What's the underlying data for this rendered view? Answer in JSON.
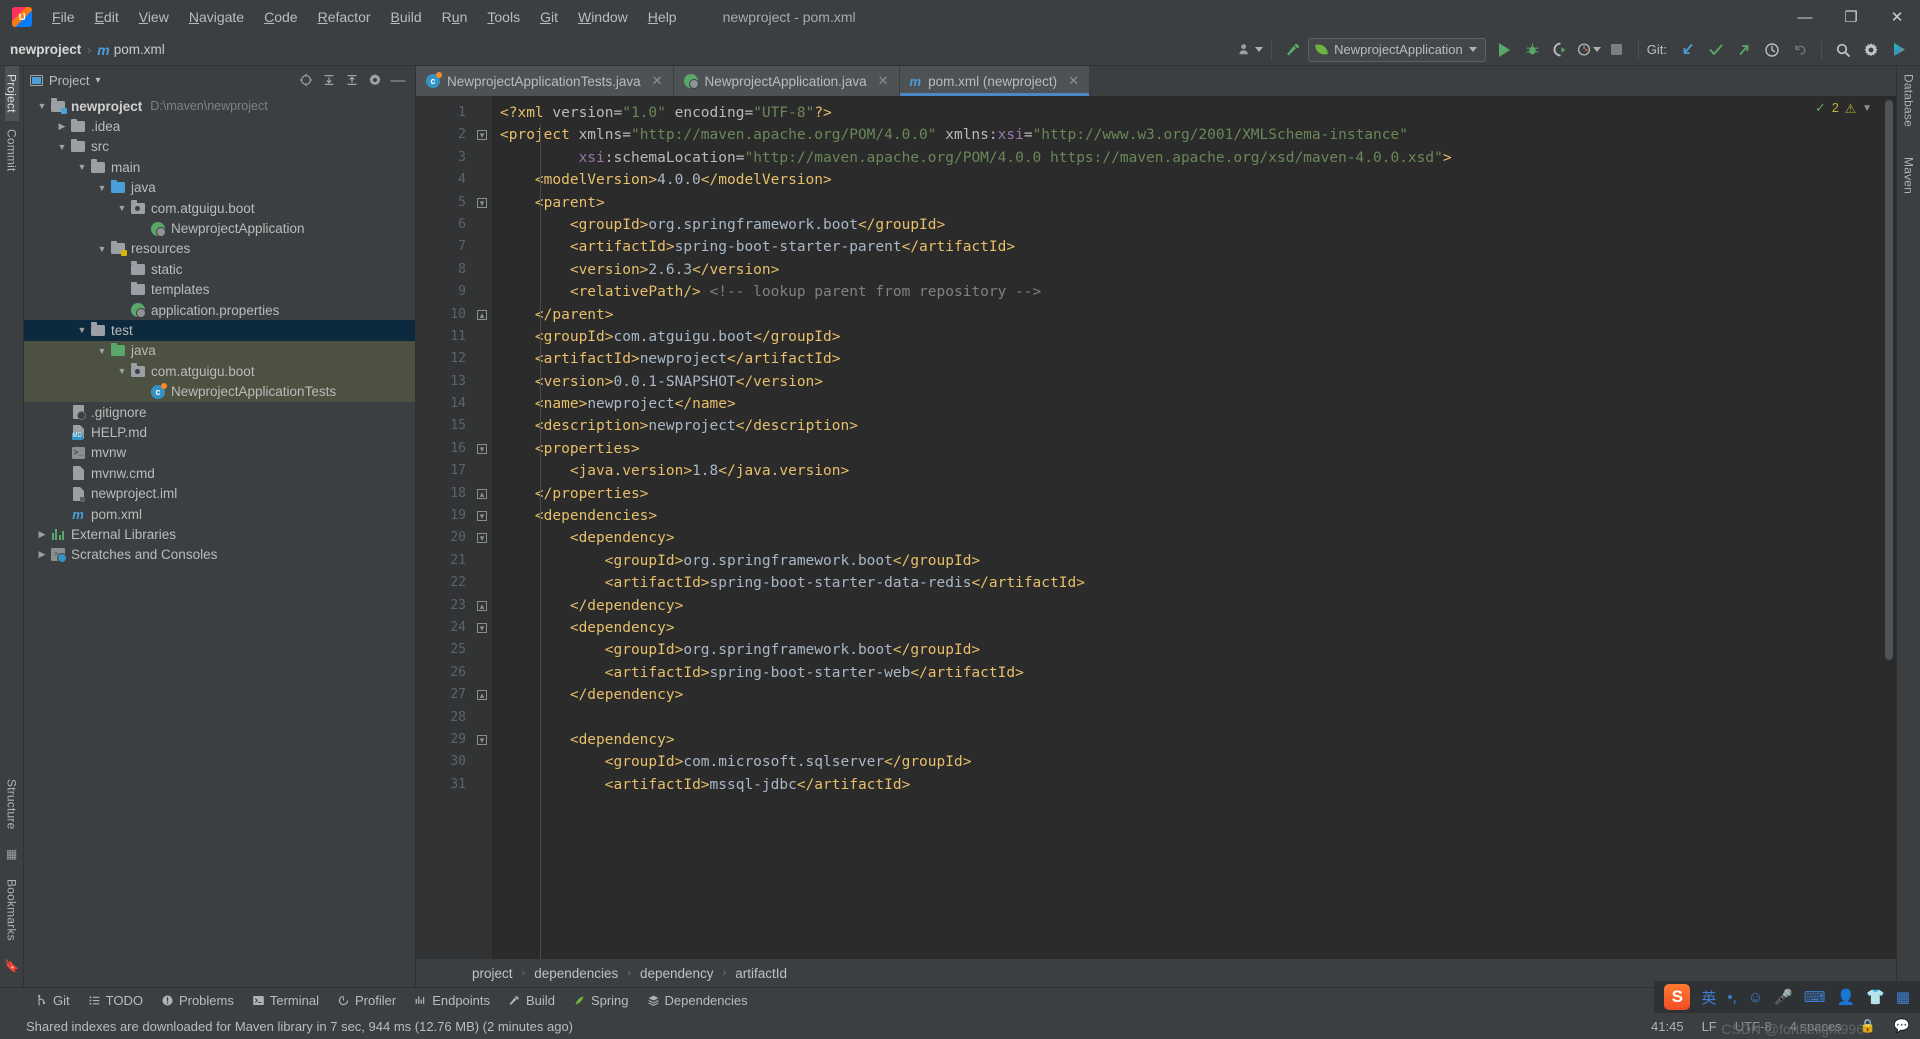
{
  "window": {
    "title": "newproject - pom.xml",
    "minimize": "—",
    "maximize": "❐",
    "close": "✕"
  },
  "menu": {
    "items": [
      {
        "pre": "",
        "u": "F",
        "post": "ile"
      },
      {
        "pre": "",
        "u": "E",
        "post": "dit"
      },
      {
        "pre": "",
        "u": "V",
        "post": "iew"
      },
      {
        "pre": "",
        "u": "N",
        "post": "avigate"
      },
      {
        "pre": "",
        "u": "C",
        "post": "ode"
      },
      {
        "pre": "",
        "u": "R",
        "post": "efactor"
      },
      {
        "pre": "",
        "u": "B",
        "post": "uild"
      },
      {
        "pre": "R",
        "u": "u",
        "post": "n"
      },
      {
        "pre": "",
        "u": "T",
        "post": "ools"
      },
      {
        "pre": "",
        "u": "G",
        "post": "it"
      },
      {
        "pre": "",
        "u": "W",
        "post": "indow"
      },
      {
        "pre": "",
        "u": "H",
        "post": "elp"
      }
    ]
  },
  "navbar": {
    "project": "newproject",
    "separator": "›",
    "file": "pom.xml",
    "file_icon_letter": "m",
    "run_config": "NewprojectApplication",
    "git_label": "Git:",
    "icons": {
      "user": "user-settings-icon",
      "build": "build-hammer-icon",
      "run": "run-icon",
      "debug": "debug-icon",
      "coverage": "run-with-coverage-icon",
      "profiler": "profiler-icon",
      "stop": "stop-icon",
      "update": "git-update-icon",
      "commit": "git-commit-icon",
      "push": "git-push-icon",
      "history": "git-history-icon",
      "rollback": "git-rollback-icon",
      "search": "search-everywhere-icon",
      "settings": "settings-gear-icon",
      "ai": "ai-assistant-icon"
    }
  },
  "left_strip": {
    "project_label": "Project",
    "commit_label": "Commit",
    "structure_label": "Structure",
    "bookmarks_label": "Bookmarks"
  },
  "right_strip": {
    "database_label": "Database",
    "maven_label": "Maven"
  },
  "project_panel": {
    "title": "Project",
    "chevron": "▾",
    "actions": [
      "locate-icon",
      "expand-all-icon",
      "collapse-all-icon",
      "settings-icon",
      "hide-icon"
    ],
    "tree": [
      {
        "indent": 0,
        "arrow": "v",
        "icon": "folder-module",
        "label": "newproject",
        "bold": true,
        "path": "D:\\maven\\newproject",
        "state": "normal"
      },
      {
        "indent": 1,
        "arrow": ">",
        "icon": "folder",
        "label": ".idea",
        "bold": false,
        "path": "",
        "state": "normal"
      },
      {
        "indent": 1,
        "arrow": "v",
        "icon": "folder",
        "label": "src",
        "bold": false,
        "path": "",
        "state": "normal"
      },
      {
        "indent": 2,
        "arrow": "v",
        "icon": "folder",
        "label": "main",
        "bold": false,
        "path": "",
        "state": "normal"
      },
      {
        "indent": 3,
        "arrow": "v",
        "icon": "folder-source",
        "label": "java",
        "bold": false,
        "path": "",
        "state": "normal"
      },
      {
        "indent": 4,
        "arrow": "v",
        "icon": "package",
        "label": "com.atguigu.boot",
        "bold": false,
        "path": "",
        "state": "normal"
      },
      {
        "indent": 5,
        "arrow": "",
        "icon": "spring-class",
        "label": "NewprojectApplication",
        "bold": false,
        "path": "",
        "state": "normal"
      },
      {
        "indent": 3,
        "arrow": "v",
        "icon": "folder-resource",
        "label": "resources",
        "bold": false,
        "path": "",
        "state": "normal"
      },
      {
        "indent": 4,
        "arrow": "",
        "icon": "folder",
        "label": "static",
        "bold": false,
        "path": "",
        "state": "normal"
      },
      {
        "indent": 4,
        "arrow": "",
        "icon": "folder",
        "label": "templates",
        "bold": false,
        "path": "",
        "state": "normal"
      },
      {
        "indent": 4,
        "arrow": "",
        "icon": "spring-props",
        "label": "application.properties",
        "bold": false,
        "path": "",
        "state": "normal"
      },
      {
        "indent": 2,
        "arrow": "v",
        "icon": "folder",
        "label": "test",
        "bold": false,
        "path": "",
        "state": "selected"
      },
      {
        "indent": 3,
        "arrow": "v",
        "icon": "folder-test",
        "label": "java",
        "bold": false,
        "path": "",
        "state": "highlight"
      },
      {
        "indent": 4,
        "arrow": "v",
        "icon": "package",
        "label": "com.atguigu.boot",
        "bold": false,
        "path": "",
        "state": "highlight"
      },
      {
        "indent": 5,
        "arrow": "",
        "icon": "test-class",
        "label": "NewprojectApplicationTests",
        "bold": false,
        "path": "",
        "state": "highlight"
      },
      {
        "indent": 1,
        "arrow": "",
        "icon": "gitignore",
        "label": ".gitignore",
        "bold": false,
        "path": "",
        "state": "normal"
      },
      {
        "indent": 1,
        "arrow": "",
        "icon": "markdown",
        "label": "HELP.md",
        "bold": false,
        "path": "",
        "state": "normal"
      },
      {
        "indent": 1,
        "arrow": "",
        "icon": "shell",
        "label": "mvnw",
        "bold": false,
        "path": "",
        "state": "normal"
      },
      {
        "indent": 1,
        "arrow": "",
        "icon": "file",
        "label": "mvnw.cmd",
        "bold": false,
        "path": "",
        "state": "normal"
      },
      {
        "indent": 1,
        "arrow": "",
        "icon": "iml",
        "label": "newproject.iml",
        "bold": false,
        "path": "",
        "state": "normal"
      },
      {
        "indent": 1,
        "arrow": "",
        "icon": "maven",
        "label": "pom.xml",
        "bold": false,
        "path": "",
        "state": "normal"
      },
      {
        "indent": 0,
        "arrow": ">",
        "icon": "libraries",
        "label": "External Libraries",
        "bold": false,
        "path": "",
        "state": "normal"
      },
      {
        "indent": 0,
        "arrow": ">",
        "icon": "scratches",
        "label": "Scratches and Consoles",
        "bold": false,
        "path": "",
        "state": "normal"
      }
    ]
  },
  "tabs": [
    {
      "label": "NewprojectApplicationTests.java",
      "icon": "test-class-icon",
      "active": false
    },
    {
      "label": "NewprojectApplication.java",
      "icon": "spring-class-icon",
      "active": false
    },
    {
      "label": "pom.xml (newproject)",
      "icon": "maven-icon",
      "active": true
    }
  ],
  "editor": {
    "inspection_count": "2",
    "first_line": 1,
    "lines": [
      {
        "n": 1,
        "fold": "",
        "segments": [
          {
            "t": "tg",
            "v": "<?xml "
          },
          {
            "t": "at",
            "v": "version="
          },
          {
            "t": "st",
            "v": "\"1.0\""
          },
          {
            "t": "at",
            "v": " encoding="
          },
          {
            "t": "st",
            "v": "\"UTF-8\""
          },
          {
            "t": "tg",
            "v": "?>"
          }
        ],
        "indent": 0
      },
      {
        "n": 2,
        "fold": "open",
        "segments": [
          {
            "t": "tg",
            "v": "<project "
          },
          {
            "t": "at",
            "v": "xmlns="
          },
          {
            "t": "st",
            "v": "\"http://maven.apache.org/POM/4.0.0\""
          },
          {
            "t": "at",
            "v": " xmlns:"
          },
          {
            "t": "at2",
            "v": "xsi"
          },
          {
            "t": "at",
            "v": "="
          },
          {
            "t": "st",
            "v": "\"http://www.w3.org/2001/XMLSchema-instance\""
          }
        ],
        "indent": 0
      },
      {
        "n": 3,
        "fold": "",
        "segments": [
          {
            "t": "at2",
            "v": "xsi"
          },
          {
            "t": "at",
            "v": ":schemaLocation="
          },
          {
            "t": "st",
            "v": "\"http://maven.apache.org/POM/4.0.0 https://maven.apache.org/xsd/maven-4.0.0.xsd\""
          },
          {
            "t": "tg",
            "v": ">"
          }
        ],
        "indent": 9
      },
      {
        "n": 4,
        "fold": "",
        "segments": [
          {
            "t": "tg",
            "v": "<modelVersion>"
          },
          {
            "t": "tx",
            "v": "4.0.0"
          },
          {
            "t": "tg",
            "v": "</modelVersion>"
          }
        ],
        "indent": 4
      },
      {
        "n": 5,
        "fold": "open",
        "segments": [
          {
            "t": "tg",
            "v": "<parent>"
          }
        ],
        "indent": 4
      },
      {
        "n": 6,
        "fold": "",
        "segments": [
          {
            "t": "tg",
            "v": "<groupId>"
          },
          {
            "t": "tx",
            "v": "org.springframework.boot"
          },
          {
            "t": "tg",
            "v": "</groupId>"
          }
        ],
        "indent": 8
      },
      {
        "n": 7,
        "fold": "",
        "segments": [
          {
            "t": "tg",
            "v": "<artifactId>"
          },
          {
            "t": "tx",
            "v": "spring-boot-starter-parent"
          },
          {
            "t": "tg",
            "v": "</artifactId>"
          }
        ],
        "indent": 8
      },
      {
        "n": 8,
        "fold": "",
        "segments": [
          {
            "t": "tg",
            "v": "<version>"
          },
          {
            "t": "tx",
            "v": "2.6.3"
          },
          {
            "t": "tg",
            "v": "</version>"
          }
        ],
        "indent": 8
      },
      {
        "n": 9,
        "fold": "",
        "segments": [
          {
            "t": "tg",
            "v": "<relativePath/>"
          },
          {
            "t": "cm",
            "v": " <!-- lookup parent from repository -->"
          }
        ],
        "indent": 8
      },
      {
        "n": 10,
        "fold": "close",
        "segments": [
          {
            "t": "tg",
            "v": "</parent>"
          }
        ],
        "indent": 4
      },
      {
        "n": 11,
        "fold": "",
        "segments": [
          {
            "t": "tg",
            "v": "<groupId>"
          },
          {
            "t": "tx",
            "v": "com.atguigu.boot"
          },
          {
            "t": "tg",
            "v": "</groupId>"
          }
        ],
        "indent": 4
      },
      {
        "n": 12,
        "fold": "",
        "segments": [
          {
            "t": "tg",
            "v": "<artifactId>"
          },
          {
            "t": "tx",
            "v": "newproject"
          },
          {
            "t": "tg",
            "v": "</artifactId>"
          }
        ],
        "indent": 4
      },
      {
        "n": 13,
        "fold": "",
        "segments": [
          {
            "t": "tg",
            "v": "<version>"
          },
          {
            "t": "tx",
            "v": "0.0.1-SNAPSHOT"
          },
          {
            "t": "tg",
            "v": "</version>"
          }
        ],
        "indent": 4
      },
      {
        "n": 14,
        "fold": "",
        "segments": [
          {
            "t": "tg",
            "v": "<name>"
          },
          {
            "t": "tx",
            "v": "newproject"
          },
          {
            "t": "tg",
            "v": "</name>"
          }
        ],
        "indent": 4
      },
      {
        "n": 15,
        "fold": "",
        "segments": [
          {
            "t": "tg",
            "v": "<description>"
          },
          {
            "t": "tx",
            "v": "newproject"
          },
          {
            "t": "tg",
            "v": "</description>"
          }
        ],
        "indent": 4
      },
      {
        "n": 16,
        "fold": "open",
        "segments": [
          {
            "t": "tg",
            "v": "<properties>"
          }
        ],
        "indent": 4
      },
      {
        "n": 17,
        "fold": "",
        "segments": [
          {
            "t": "tg",
            "v": "<java.version>"
          },
          {
            "t": "tx",
            "v": "1.8"
          },
          {
            "t": "tg",
            "v": "</java.version>"
          }
        ],
        "indent": 8
      },
      {
        "n": 18,
        "fold": "close",
        "segments": [
          {
            "t": "tg",
            "v": "</properties>"
          }
        ],
        "indent": 4
      },
      {
        "n": 19,
        "fold": "open",
        "segments": [
          {
            "t": "tg",
            "v": "<dependencies>"
          }
        ],
        "indent": 4
      },
      {
        "n": 20,
        "fold": "open",
        "segments": [
          {
            "t": "tg",
            "v": "<dependency>"
          }
        ],
        "indent": 8
      },
      {
        "n": 21,
        "fold": "",
        "segments": [
          {
            "t": "tg",
            "v": "<groupId>"
          },
          {
            "t": "tx",
            "v": "org.springframework.boot"
          },
          {
            "t": "tg",
            "v": "</groupId>"
          }
        ],
        "indent": 12
      },
      {
        "n": 22,
        "fold": "",
        "segments": [
          {
            "t": "tg",
            "v": "<artifactId>"
          },
          {
            "t": "tx",
            "v": "spring-boot-starter-data-redis"
          },
          {
            "t": "tg",
            "v": "</artifactId>"
          }
        ],
        "indent": 12
      },
      {
        "n": 23,
        "fold": "close",
        "segments": [
          {
            "t": "tg",
            "v": "</dependency>"
          }
        ],
        "indent": 8
      },
      {
        "n": 24,
        "fold": "open",
        "segments": [
          {
            "t": "tg",
            "v": "<dependency>"
          }
        ],
        "indent": 8
      },
      {
        "n": 25,
        "fold": "",
        "segments": [
          {
            "t": "tg",
            "v": "<groupId>"
          },
          {
            "t": "tx",
            "v": "org.springframework.boot"
          },
          {
            "t": "tg",
            "v": "</groupId>"
          }
        ],
        "indent": 12
      },
      {
        "n": 26,
        "fold": "",
        "segments": [
          {
            "t": "tg",
            "v": "<artifactId>"
          },
          {
            "t": "tx",
            "v": "spring-boot-starter-web"
          },
          {
            "t": "tg",
            "v": "</artifactId>"
          }
        ],
        "indent": 12
      },
      {
        "n": 27,
        "fold": "close",
        "segments": [
          {
            "t": "tg",
            "v": "</dependency>"
          }
        ],
        "indent": 8
      },
      {
        "n": 28,
        "fold": "",
        "segments": [],
        "indent": 0
      },
      {
        "n": 29,
        "fold": "open",
        "segments": [
          {
            "t": "tg",
            "v": "<dependency>"
          }
        ],
        "indent": 8
      },
      {
        "n": 30,
        "fold": "",
        "segments": [
          {
            "t": "tg",
            "v": "<groupId>"
          },
          {
            "t": "tx",
            "v": "com.microsoft.sqlserver"
          },
          {
            "t": "tg",
            "v": "</groupId>"
          }
        ],
        "indent": 12
      },
      {
        "n": 31,
        "fold": "",
        "segments": [
          {
            "t": "tg",
            "v": "<artifactId>"
          },
          {
            "t": "tx",
            "v": "mssql-jdbc"
          },
          {
            "t": "tg",
            "v": "</artifactId>"
          }
        ],
        "indent": 12
      }
    ]
  },
  "breadcrumb": {
    "items": [
      "project",
      "dependencies",
      "dependency",
      "artifactId"
    ],
    "separator": "›"
  },
  "tool_windows": [
    {
      "label": "Git",
      "icon": "git-branch-icon"
    },
    {
      "label": "TODO",
      "icon": "todo-list-icon"
    },
    {
      "label": "Problems",
      "icon": "problems-icon"
    },
    {
      "label": "Terminal",
      "icon": "terminal-icon"
    },
    {
      "label": "Profiler",
      "icon": "profiler-icon"
    },
    {
      "label": "Endpoints",
      "icon": "endpoints-icon"
    },
    {
      "label": "Build",
      "icon": "build-hammer-icon"
    },
    {
      "label": "Spring",
      "icon": "spring-leaf-icon"
    },
    {
      "label": "Dependencies",
      "icon": "dependencies-icon"
    }
  ],
  "status_bar": {
    "message": "Shared indexes are downloaded for Maven library in 7 sec, 944 ms (12.76 MB) (2 minutes ago)",
    "caret": "41:45",
    "line_separator": "LF",
    "encoding": "UTF-8",
    "indent": "4 spaces",
    "watermark": "CSDN @forthelight996"
  },
  "tray": {
    "sogou": "S",
    "items": [
      "英",
      "•,",
      "☺",
      "mic-icon",
      "keyboard-icon",
      "toolbox-icon",
      "shirt-icon",
      "apps-icon"
    ]
  },
  "colors": {
    "accent": "#4a88c7",
    "green": "#59a869",
    "tag": "#e8bf6a",
    "string": "#6a8759",
    "selection": "#0d293e",
    "highlight": "#4c5142"
  }
}
